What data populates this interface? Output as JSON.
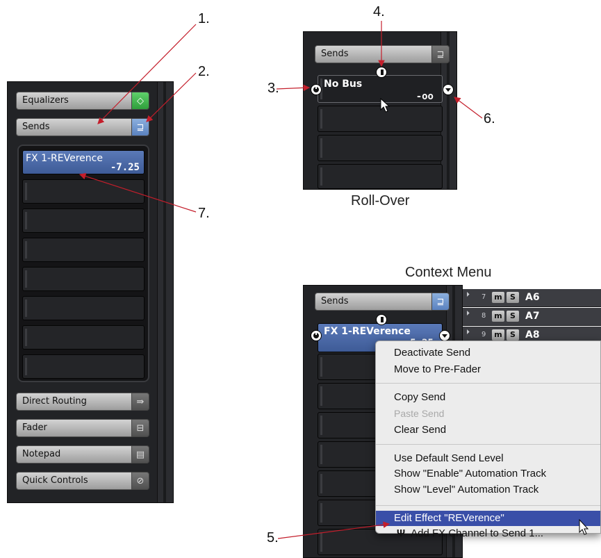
{
  "left_panel": {
    "equalizers_label": "Equalizers",
    "sends_label": "Sends",
    "active_send": {
      "name": "FX 1-REVerence",
      "level": "-7.25"
    },
    "direct_routing_label": "Direct Routing",
    "fader_label": "Fader",
    "notepad_label": "Notepad",
    "quick_controls_label": "Quick Controls"
  },
  "rollover_panel": {
    "sends_label": "Sends",
    "slot_name": "No Bus",
    "slot_level": "-oo",
    "caption": "Roll-Over"
  },
  "context_panel": {
    "caption": "Context Menu",
    "sends_label": "Sends",
    "slot_name": "FX 1-REVerence",
    "slot_level": "-5.25",
    "tracks": [
      {
        "num": "7",
        "m": "m",
        "s": "S",
        "name": "A6"
      },
      {
        "num": "8",
        "m": "m",
        "s": "S",
        "name": "A7"
      },
      {
        "num": "9",
        "m": "m",
        "s": "S",
        "name": "A8"
      }
    ],
    "menu": {
      "deactivate": "Deactivate Send",
      "move_pre": "Move to Pre-Fader",
      "copy": "Copy Send",
      "paste": "Paste Send",
      "clear": "Clear Send",
      "use_default": "Use Default Send Level",
      "show_enable": "Show \"Enable\" Automation Track",
      "show_level": "Show \"Level\" Automation Track",
      "edit_effect": "Edit Effect \"REVerence\"",
      "add_fx": "Add FX Channel to Send 1..."
    }
  },
  "callouts": {
    "n1": "1.",
    "n2": "2.",
    "n3": "3.",
    "n4": "4.",
    "n5": "5.",
    "n6": "6.",
    "n7": "7."
  },
  "colors": {
    "arrow": "#c41e2b",
    "active_send": "#4a68a8",
    "menu_highlight": "#3a4fa8"
  }
}
